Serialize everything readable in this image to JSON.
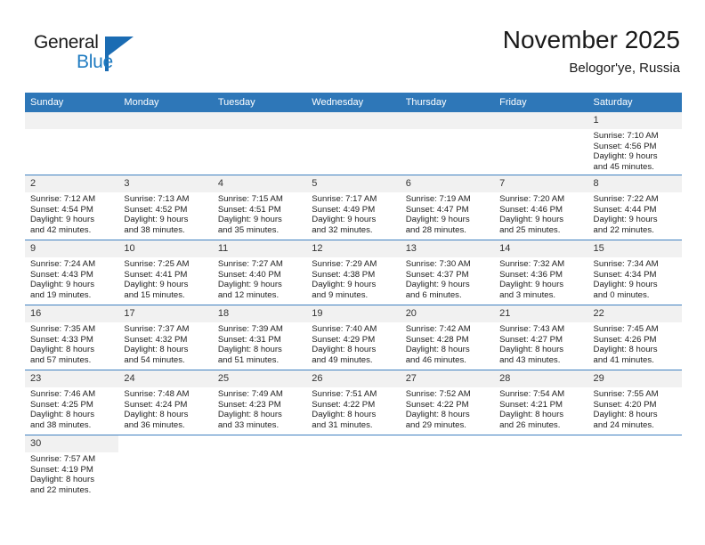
{
  "brand": {
    "name_part1": "General",
    "name_part2": "Blue",
    "accent_color": "#1b6cb3"
  },
  "header": {
    "title": "November 2025",
    "subtitle": "Belogor'ye, Russia"
  },
  "theme": {
    "header_blue": "#2e77b8",
    "row_divider_blue": "#3f80c0",
    "daynum_band": "#f1f1f1"
  },
  "weekdays": [
    "Sunday",
    "Monday",
    "Tuesday",
    "Wednesday",
    "Thursday",
    "Friday",
    "Saturday"
  ],
  "labels": {
    "sunrise_prefix": "Sunrise:",
    "sunset_prefix": "Sunset:",
    "daylight_prefix": "Daylight:"
  },
  "weeks": [
    [
      {
        "day": "",
        "lines": []
      },
      {
        "day": "",
        "lines": []
      },
      {
        "day": "",
        "lines": []
      },
      {
        "day": "",
        "lines": []
      },
      {
        "day": "",
        "lines": []
      },
      {
        "day": "",
        "lines": []
      },
      {
        "day": "1",
        "lines": [
          "Sunrise: 7:10 AM",
          "Sunset: 4:56 PM",
          "Daylight: 9 hours",
          "and 45 minutes."
        ]
      }
    ],
    [
      {
        "day": "2",
        "lines": [
          "Sunrise: 7:12 AM",
          "Sunset: 4:54 PM",
          "Daylight: 9 hours",
          "and 42 minutes."
        ]
      },
      {
        "day": "3",
        "lines": [
          "Sunrise: 7:13 AM",
          "Sunset: 4:52 PM",
          "Daylight: 9 hours",
          "and 38 minutes."
        ]
      },
      {
        "day": "4",
        "lines": [
          "Sunrise: 7:15 AM",
          "Sunset: 4:51 PM",
          "Daylight: 9 hours",
          "and 35 minutes."
        ]
      },
      {
        "day": "5",
        "lines": [
          "Sunrise: 7:17 AM",
          "Sunset: 4:49 PM",
          "Daylight: 9 hours",
          "and 32 minutes."
        ]
      },
      {
        "day": "6",
        "lines": [
          "Sunrise: 7:19 AM",
          "Sunset: 4:47 PM",
          "Daylight: 9 hours",
          "and 28 minutes."
        ]
      },
      {
        "day": "7",
        "lines": [
          "Sunrise: 7:20 AM",
          "Sunset: 4:46 PM",
          "Daylight: 9 hours",
          "and 25 minutes."
        ]
      },
      {
        "day": "8",
        "lines": [
          "Sunrise: 7:22 AM",
          "Sunset: 4:44 PM",
          "Daylight: 9 hours",
          "and 22 minutes."
        ]
      }
    ],
    [
      {
        "day": "9",
        "lines": [
          "Sunrise: 7:24 AM",
          "Sunset: 4:43 PM",
          "Daylight: 9 hours",
          "and 19 minutes."
        ]
      },
      {
        "day": "10",
        "lines": [
          "Sunrise: 7:25 AM",
          "Sunset: 4:41 PM",
          "Daylight: 9 hours",
          "and 15 minutes."
        ]
      },
      {
        "day": "11",
        "lines": [
          "Sunrise: 7:27 AM",
          "Sunset: 4:40 PM",
          "Daylight: 9 hours",
          "and 12 minutes."
        ]
      },
      {
        "day": "12",
        "lines": [
          "Sunrise: 7:29 AM",
          "Sunset: 4:38 PM",
          "Daylight: 9 hours",
          "and 9 minutes."
        ]
      },
      {
        "day": "13",
        "lines": [
          "Sunrise: 7:30 AM",
          "Sunset: 4:37 PM",
          "Daylight: 9 hours",
          "and 6 minutes."
        ]
      },
      {
        "day": "14",
        "lines": [
          "Sunrise: 7:32 AM",
          "Sunset: 4:36 PM",
          "Daylight: 9 hours",
          "and 3 minutes."
        ]
      },
      {
        "day": "15",
        "lines": [
          "Sunrise: 7:34 AM",
          "Sunset: 4:34 PM",
          "Daylight: 9 hours",
          "and 0 minutes."
        ]
      }
    ],
    [
      {
        "day": "16",
        "lines": [
          "Sunrise: 7:35 AM",
          "Sunset: 4:33 PM",
          "Daylight: 8 hours",
          "and 57 minutes."
        ]
      },
      {
        "day": "17",
        "lines": [
          "Sunrise: 7:37 AM",
          "Sunset: 4:32 PM",
          "Daylight: 8 hours",
          "and 54 minutes."
        ]
      },
      {
        "day": "18",
        "lines": [
          "Sunrise: 7:39 AM",
          "Sunset: 4:31 PM",
          "Daylight: 8 hours",
          "and 51 minutes."
        ]
      },
      {
        "day": "19",
        "lines": [
          "Sunrise: 7:40 AM",
          "Sunset: 4:29 PM",
          "Daylight: 8 hours",
          "and 49 minutes."
        ]
      },
      {
        "day": "20",
        "lines": [
          "Sunrise: 7:42 AM",
          "Sunset: 4:28 PM",
          "Daylight: 8 hours",
          "and 46 minutes."
        ]
      },
      {
        "day": "21",
        "lines": [
          "Sunrise: 7:43 AM",
          "Sunset: 4:27 PM",
          "Daylight: 8 hours",
          "and 43 minutes."
        ]
      },
      {
        "day": "22",
        "lines": [
          "Sunrise: 7:45 AM",
          "Sunset: 4:26 PM",
          "Daylight: 8 hours",
          "and 41 minutes."
        ]
      }
    ],
    [
      {
        "day": "23",
        "lines": [
          "Sunrise: 7:46 AM",
          "Sunset: 4:25 PM",
          "Daylight: 8 hours",
          "and 38 minutes."
        ]
      },
      {
        "day": "24",
        "lines": [
          "Sunrise: 7:48 AM",
          "Sunset: 4:24 PM",
          "Daylight: 8 hours",
          "and 36 minutes."
        ]
      },
      {
        "day": "25",
        "lines": [
          "Sunrise: 7:49 AM",
          "Sunset: 4:23 PM",
          "Daylight: 8 hours",
          "and 33 minutes."
        ]
      },
      {
        "day": "26",
        "lines": [
          "Sunrise: 7:51 AM",
          "Sunset: 4:22 PM",
          "Daylight: 8 hours",
          "and 31 minutes."
        ]
      },
      {
        "day": "27",
        "lines": [
          "Sunrise: 7:52 AM",
          "Sunset: 4:22 PM",
          "Daylight: 8 hours",
          "and 29 minutes."
        ]
      },
      {
        "day": "28",
        "lines": [
          "Sunrise: 7:54 AM",
          "Sunset: 4:21 PM",
          "Daylight: 8 hours",
          "and 26 minutes."
        ]
      },
      {
        "day": "29",
        "lines": [
          "Sunrise: 7:55 AM",
          "Sunset: 4:20 PM",
          "Daylight: 8 hours",
          "and 24 minutes."
        ]
      }
    ],
    [
      {
        "day": "30",
        "lines": [
          "Sunrise: 7:57 AM",
          "Sunset: 4:19 PM",
          "Daylight: 8 hours",
          "and 22 minutes."
        ]
      },
      {
        "day": "",
        "lines": []
      },
      {
        "day": "",
        "lines": []
      },
      {
        "day": "",
        "lines": []
      },
      {
        "day": "",
        "lines": []
      },
      {
        "day": "",
        "lines": []
      },
      {
        "day": "",
        "lines": []
      }
    ]
  ]
}
